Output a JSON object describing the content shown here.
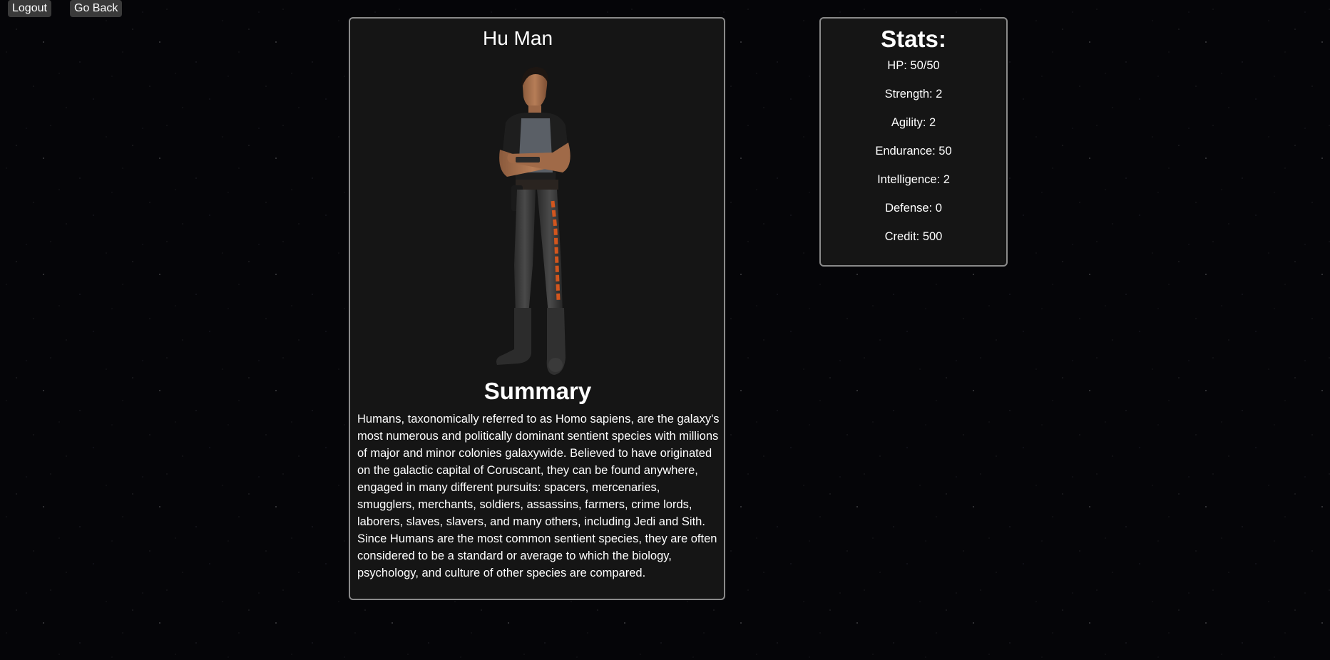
{
  "nav": {
    "logout_label": "Logout",
    "go_back_label": "Go Back"
  },
  "character": {
    "name": "Hu Man",
    "portrait_icon": "human-soldier-portrait",
    "summary_title": "Summary",
    "summary_text": "Humans, taxonomically referred to as Homo sapiens, are the galaxy's most numerous and politically dominant sentient species with millions of major and minor colonies galaxywide. Believed to have originated on the galactic capital of Coruscant, they can be found anywhere, engaged in many different pursuits: spacers, mercenaries, smugglers, merchants, soldiers, assassins, farmers, crime lords, laborers, slaves, slavers, and many others, including Jedi and Sith. Since Humans are the most common sentient species, they are often considered to be a standard or average to which the biology, psychology, and culture of other species are compared."
  },
  "stats": {
    "title": "Stats:",
    "items": [
      "HP: 50/50",
      "Strength: 2",
      "Agility: 2",
      "Endurance: 50",
      "Intelligence: 2",
      "Defense: 0",
      "Credit: 500"
    ]
  },
  "colors": {
    "background": "#050508",
    "card_background": "#151515",
    "card_border": "#8a8a8a",
    "button_background": "#3a3a3a",
    "text": "#ffffff"
  }
}
